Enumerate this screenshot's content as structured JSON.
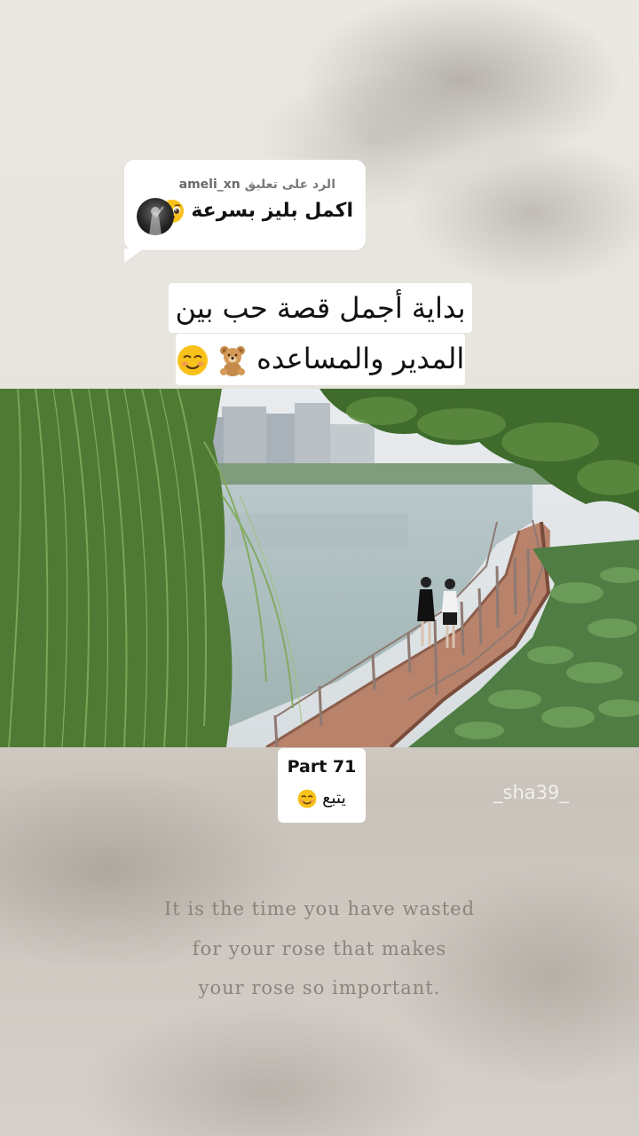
{
  "reply": {
    "prefix": "الرد على تعليق",
    "username": "ameli_xn",
    "comment": "اكمل بليز بسرعة",
    "comment_emoji": "pleading-face"
  },
  "caption": {
    "line1": "بداية أجمل قصة حب بين",
    "line2": "المدير والمساعده",
    "line2_emojis": [
      "teddy-bear",
      "smiling-face"
    ]
  },
  "part": {
    "label": "Part 71",
    "follow": "يتبع",
    "follow_emoji": "smiling-face"
  },
  "watermark": "_sha39_",
  "quote": {
    "line1": "It is the time you have wasted",
    "line2": "for your rose that makes",
    "line3": "your rose so important."
  }
}
